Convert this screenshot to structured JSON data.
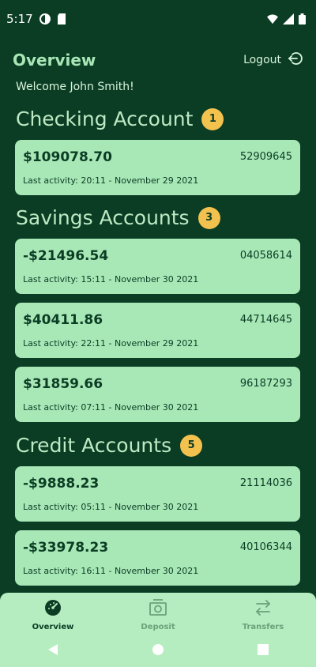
{
  "status_bar": {
    "time": "5:17"
  },
  "header": {
    "title": "Overview",
    "logout_label": "Logout"
  },
  "welcome": "Welcome John Smith!",
  "checking": {
    "title": "Checking Account",
    "count": "1",
    "accounts": [
      {
        "amount": "$109078.70",
        "number": "52909645",
        "activity": "Last activity: 20:11 - November 29 2021"
      }
    ]
  },
  "savings": {
    "title": "Savings Accounts",
    "count": "3",
    "accounts": [
      {
        "amount": "-$21496.54",
        "number": "04058614",
        "activity": "Last activity: 15:11 - November 30 2021"
      },
      {
        "amount": "$40411.86",
        "number": "44714645",
        "activity": "Last activity: 22:11 - November 29 2021"
      },
      {
        "amount": "$31859.66",
        "number": "96187293",
        "activity": "Last activity: 07:11 - November 30 2021"
      }
    ]
  },
  "credit": {
    "title": "Credit Accounts",
    "count": "5",
    "accounts": [
      {
        "amount": "-$9888.23",
        "number": "21114036",
        "activity": "Last activity: 05:11 - November 30 2021"
      },
      {
        "amount": "-$33978.23",
        "number": "40106344",
        "activity": "Last activity: 16:11 - November 30 2021"
      }
    ]
  },
  "bottom_nav": {
    "overview": "Overview",
    "deposit": "Deposit",
    "transfers": "Transfers"
  },
  "colors": {
    "background": "#0b3d24",
    "card": "#a8e7b6",
    "badge": "#f2c14e",
    "nav": "#b5ecc0"
  }
}
